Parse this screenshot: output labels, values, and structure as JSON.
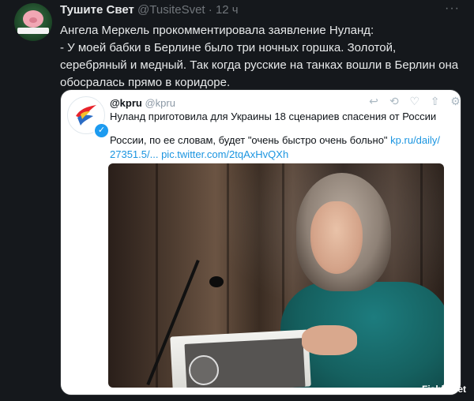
{
  "tweet": {
    "display_name": "Тушите Свет",
    "handle": "@TusiteSvet",
    "dot": "·",
    "time": "12 ч",
    "more_icon": "more-horizontal-icon",
    "lines": [
      "Ангела Меркель прокомментировала заявление Нуланд:",
      "- У моей бабки в Берлине было три ночных горшка. Золотой,",
      "серебряный и медный. Так когда русские на танках вошли в Берлин она",
      "обосралась прямо в коридоре."
    ]
  },
  "quote": {
    "name": "@kpru",
    "handle": "@kpru",
    "title": "Нуланд приготовила для Украины 18 сценариев спасения от России",
    "body_line1": "России, по ее словам, будет \"очень быстро очень больно\"",
    "link1": "kp.ru/daily/",
    "body_line2": "27351.5/...",
    "link2": "pic.twitter.com/2tqAxHvQXh",
    "actions": [
      "reply-icon",
      "retweet-icon",
      "like-icon",
      "share-icon",
      "settings-icon"
    ],
    "action_glyphs": [
      "↩",
      "⟲",
      "♡",
      "⇧",
      "⚙"
    ],
    "verified_glyph": "✓"
  },
  "watermark": "Fishki.net",
  "colors": {
    "background": "#15181c",
    "text": "#e7e9ea",
    "muted": "#71767b",
    "link": "#1b95e0",
    "verified": "#1d9bf0",
    "card_bg": "#ffffff"
  }
}
